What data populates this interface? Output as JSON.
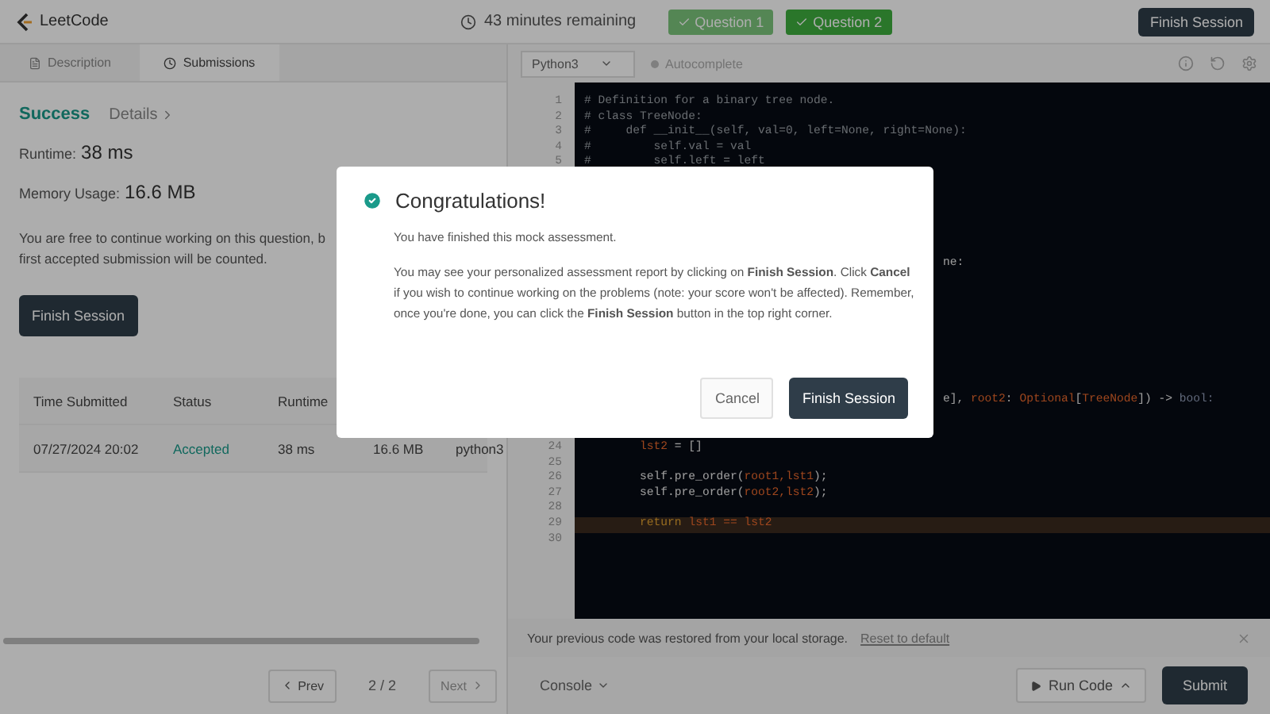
{
  "header": {
    "logo": "LeetCode",
    "timer": "43 minutes remaining",
    "questions": [
      {
        "label": "Question 1",
        "selected": false
      },
      {
        "label": "Question 2",
        "selected": true
      }
    ],
    "finish_button": "Finish Session"
  },
  "left_tabs": [
    {
      "label": "Description",
      "selected": false
    },
    {
      "label": "Submissions",
      "selected": true
    }
  ],
  "result": {
    "status": "Success",
    "details": "Details",
    "runtime_label": "Runtime:",
    "runtime": "38 ms",
    "memory_label": "Memory Usage:",
    "memory": "16.6 MB",
    "note_lines": [
      "You are free to continue working on this question, b",
      "first accepted submission will be counted."
    ],
    "finish_button": "Finish Session"
  },
  "table": {
    "columns": [
      "Time Submitted",
      "Status",
      "Runtime"
    ],
    "rows": [
      {
        "cells": [
          "07/27/2024 20:02",
          "Accepted",
          "38 ms",
          "16.6 MB",
          "python3"
        ]
      }
    ]
  },
  "pagination": {
    "prev": "Prev",
    "page": "2 / 2",
    "next": "Next",
    "next_disabled": true
  },
  "editor_toolbar": {
    "language": "Python3",
    "autocomplete": "Autocomplete"
  },
  "code": {
    "top_lines": [
      {
        "number": "1",
        "tokens": [
          {
            "kind": "comment",
            "text": "# Definition for a binary tree node."
          }
        ]
      },
      {
        "number": "2",
        "tokens": [
          {
            "kind": "comment",
            "text": "# class TreeNode:"
          }
        ]
      },
      {
        "number": "3",
        "tokens": [
          {
            "kind": "comment",
            "text": "#     def __init__(self, val=0, left=None, right=None):"
          }
        ]
      },
      {
        "number": "4",
        "tokens": [
          {
            "kind": "comment",
            "text": "#         self.val = val"
          }
        ]
      },
      {
        "number": "5",
        "tokens": [
          {
            "kind": "comment",
            "text": "#         self.left = left"
          }
        ]
      }
    ],
    "covered_lines": [
      {
        "tokens": [
          {
            "kind": "plain",
            "text": "ne:"
          }
        ]
      },
      {
        "tokens": [
          {
            "kind": "plain",
            "text": "e], "
          },
          {
            "kind": "variable",
            "text": "root2"
          },
          {
            "kind": "plain",
            "text": ": "
          },
          {
            "kind": "variable",
            "text": "Optional"
          },
          {
            "kind": "plain",
            "text": "["
          },
          {
            "kind": "variable",
            "text": "TreeNode"
          },
          {
            "kind": "plain",
            "text": "]) -> "
          },
          {
            "kind": "type",
            "text": "bool:"
          }
        ]
      }
    ],
    "bottom_lines": [
      {
        "number": "24",
        "highlighted": false,
        "tokens": [
          {
            "kind": "variable",
            "text": "        lst2"
          },
          {
            "kind": "plain",
            "text": " = []"
          }
        ]
      },
      {
        "number": "25",
        "highlighted": false
      },
      {
        "number": "26",
        "highlighted": false,
        "tokens": [
          {
            "kind": "plain",
            "text": "        self.pre_order("
          },
          {
            "kind": "variable",
            "text": "root1,lst1"
          },
          {
            "kind": "plain",
            "text": ");"
          }
        ]
      },
      {
        "number": "27",
        "highlighted": false,
        "tokens": [
          {
            "kind": "plain",
            "text": "        self.pre_order("
          },
          {
            "kind": "variable",
            "text": "root2,lst2"
          },
          {
            "kind": "plain",
            "text": ");"
          }
        ]
      },
      {
        "number": "28",
        "highlighted": false
      },
      {
        "number": "29",
        "highlighted": true,
        "tokens": [
          {
            "kind": "keyword",
            "text": "        return "
          },
          {
            "kind": "variable",
            "text": "lst1 == lst2"
          }
        ]
      },
      {
        "number": "30",
        "highlighted": false
      }
    ]
  },
  "notice": {
    "text": "Your previous code was restored from your local storage.",
    "link": "Reset to default"
  },
  "footer": {
    "console": "Console",
    "run": "Run Code",
    "submit": "Submit"
  },
  "modal": {
    "title": "Congratulations!",
    "paragraphs": [
      "You have finished this mock assessment.",
      "You may see your personalized assessment report by clicking on **Finish Session**. Click **Cancel** if you wish to continue working on the problems (note: your score won't be affected). Remember, once you're done, you can click the **Finish Session** button in the top right corner."
    ],
    "cancel": "Cancel",
    "confirm": "Finish Session"
  }
}
